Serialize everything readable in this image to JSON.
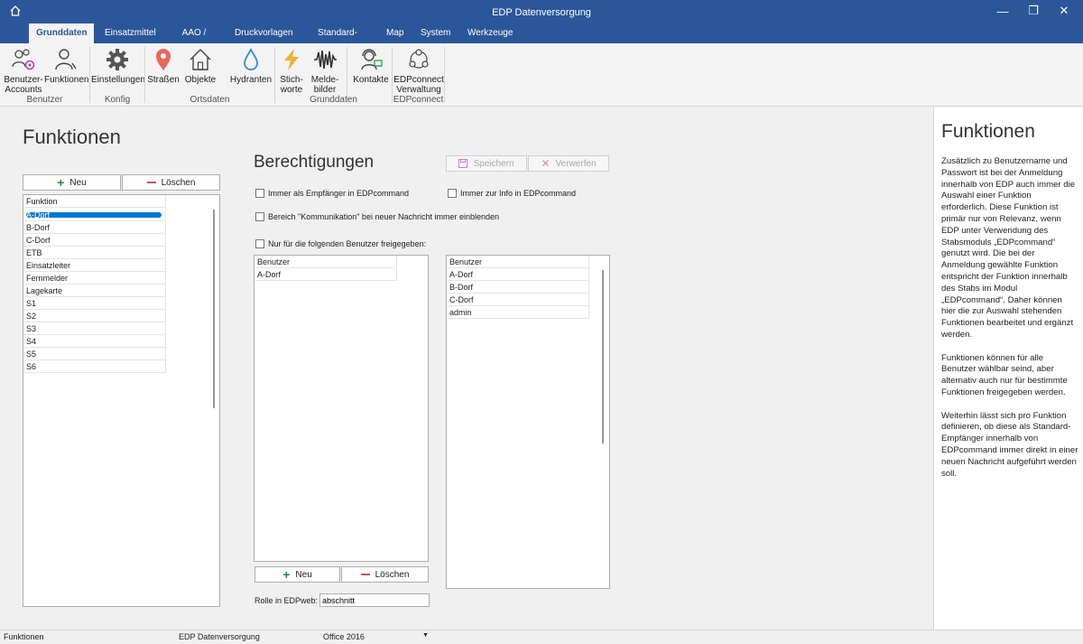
{
  "window": {
    "title": "EDP Datenversorgung",
    "minimize": "—",
    "restore": "❐",
    "close": "✕"
  },
  "tabs": [
    "Grunddaten",
    "Einsatzmittel",
    "AAO / Alarm",
    "Druckvorlagen",
    "Standard-Texte",
    "Map",
    "System",
    "Werkzeuge"
  ],
  "ribbon": {
    "buttons": [
      {
        "line1": "Benutzer-",
        "line2": "Accounts",
        "icon": "users-gear-icon"
      },
      {
        "line1": "Funktionen",
        "line2": "",
        "icon": "user-function-icon"
      },
      {
        "line1": "Einstellungen",
        "line2": "",
        "icon": "gear-icon"
      },
      {
        "line1": "Straßen",
        "line2": "",
        "icon": "map-pin-icon"
      },
      {
        "line1": "Objekte",
        "line2": "",
        "icon": "house-icon"
      },
      {
        "line1": "Hydranten",
        "line2": "",
        "icon": "water-drop-icon"
      },
      {
        "line1": "Stich-",
        "line2": "worte",
        "icon": "lightning-icon"
      },
      {
        "line1": "Melde-",
        "line2": "bilder",
        "icon": "waveform-icon"
      },
      {
        "line1": "Kontakte",
        "line2": "",
        "icon": "headset-contact-icon"
      },
      {
        "line1": "EDPconnect",
        "line2": "Verwaltung",
        "icon": "network-icon"
      }
    ],
    "groups": [
      "Benutzer",
      "Konfig",
      "Ortsdaten",
      "Grunddaten",
      "EDPconnect"
    ]
  },
  "main": {
    "title": "Funktionen",
    "new_label": "Neu",
    "delete_label": "Löschen",
    "functions_header": "Funktion",
    "functions": [
      "A-Dorf",
      "B-Dorf",
      "C-Dorf",
      "ETB",
      "Einsatzleiter",
      "Fernmelder",
      "Lagekarte",
      "S1",
      "S2",
      "S3",
      "S4",
      "S5",
      "S6"
    ],
    "selected_function": "A-Dorf"
  },
  "permissions": {
    "title": "Berechtigungen",
    "save_label": "Speichern",
    "discard_label": "Verwerfen",
    "always_recipient": "Immer als Empfänger in EDPcommand",
    "always_info": "Immer zur Info in EDPcommand",
    "communication_area": "Bereich \"Kommunikation\" bei neuer Nachricht immer einblenden",
    "only_users": "Nur für die folgenden Benutzer freigegeben:",
    "left_header": "Benutzer",
    "left_users": [
      "A-Dorf"
    ],
    "right_header": "Benutzer",
    "right_users": [
      "A-Dorf",
      "B-Dorf",
      "C-Dorf",
      "admin"
    ],
    "new_label": "Neu",
    "delete_label": "Löschen",
    "role_label": "Rolle in EDPweb:",
    "role_value": "abschnitt"
  },
  "help": {
    "title": "Funktionen",
    "p1": "Zusätzlich zu Benutzername und Passwort ist bei der Anmeldung innerhalb von EDP auch immer die Auswahl einer Funktion erforderlich. Diese Funktion ist primär nur von Relevanz, wenn EDP unter Verwendung des Stabsmoduls „EDPcommand“ genutzt wird. Die bei der Anmeldung gewählte Funktion entspricht der Funktion innerhalb des Stabs im Modul „EDPcommand“. Daher können hier die zur Auswahl stehenden Funktionen bearbeitet und ergänzt werden.",
    "p2": "Funktionen können für alle Benutzer wählbar seind, aber alternativ auch nur für bestimmte Funktionen freigegeben werden.",
    "p3": "Weiterhin lässt sich pro Funktion definieren, ob diese als Standard-Empfänger innerhalb von EDPcommand immer direkt in einer neuen Nachricht aufgeführt werden soll."
  },
  "status": {
    "left": "Funktionen",
    "mid": "EDP Datenversorgung",
    "theme": "Office 2016"
  },
  "colors": {
    "accent": "#2b579a",
    "selection": "#0078d7",
    "add": "#2e8b2e",
    "delete": "#d9534f"
  }
}
